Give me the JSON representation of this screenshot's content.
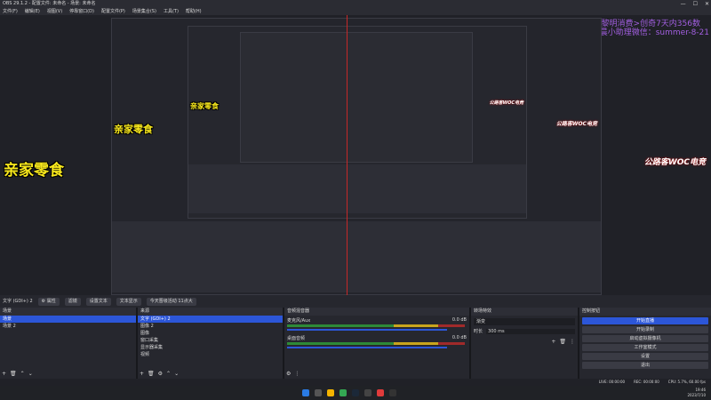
{
  "titlebar": {
    "title": "OBS 29.1.2 - 配置文件: 未命名 - 场景: 未命名",
    "min": "—",
    "max": "☐",
    "close": "✕"
  },
  "menu": [
    "文件(F)",
    "编辑(E)",
    "视图(V)",
    "停靠窗口(D)",
    "配置文件(P)",
    "场景集合(S)",
    "工具(T)",
    "帮助(H)"
  ],
  "preview": {
    "overlay_title": "今天晋级活动 11点大",
    "purple_lines": [
      "<黎明消费>创奇7天内356数",
      "刷晨小助理微信：summer-8-21"
    ],
    "yellow_text": "亲家零食",
    "logo_text": "公路客WOC电竞"
  },
  "scene_bar": {
    "current": "文字 (GDI+) 2",
    "properties": "⚙ 属性",
    "filters": "滤镜",
    "text_btn": "设置文本",
    "text_btn2": "文本显示",
    "marquee": "今天晋级活动 11点大"
  },
  "scenes": {
    "header": "场景",
    "items": [
      "场景",
      "场景 2"
    ]
  },
  "sources": {
    "header": "来源",
    "items": [
      "文字 (GDI+) 2",
      "图像 2",
      "图像",
      "窗口采集",
      "显示器采集",
      "视频"
    ]
  },
  "mixer": {
    "header": "音频混音器",
    "channels": [
      {
        "name": "麦克风/Aux",
        "db": "0.0 dB"
      },
      {
        "name": "桌面音频",
        "db": "0.0 dB"
      }
    ]
  },
  "transitions": {
    "header": "转场特效",
    "type": "渐变",
    "duration_label": "时长",
    "duration": "300 ms"
  },
  "controls": {
    "header": "控制按钮",
    "buttons": [
      "开始直播",
      "开始录制",
      "启动虚拟摄像机",
      "工作室模式",
      "设置",
      "退出"
    ]
  },
  "status": {
    "live": "LIVE: 00:00:00",
    "rec": "REC: 00:00:00",
    "cpu": "CPU: 5.7%, 60.00 fps"
  },
  "clock": {
    "time": "19:46",
    "date": "2023/7/10"
  },
  "colors": {
    "accent": "#2c56d8",
    "start_stream": "#2c56d8"
  }
}
